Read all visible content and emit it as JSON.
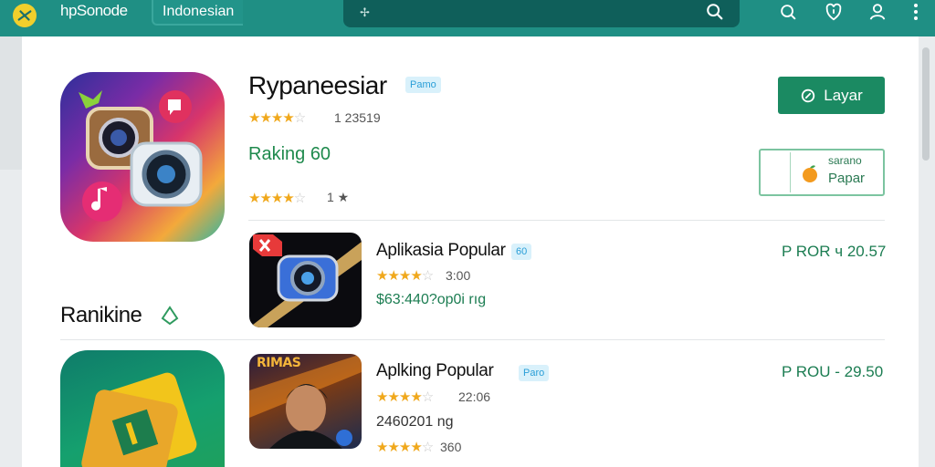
{
  "header": {
    "brand": "hpSonode",
    "language": "Indonesian",
    "search": {
      "value": ""
    }
  },
  "featured": {
    "title": "Rypaneesiar",
    "badge": "Pamo",
    "rating_stars": 4,
    "rating_text": "1 23519",
    "ranking": "Raking 60",
    "secondary_stars": 4,
    "secondary_text": "1 ★",
    "install_label": "Layar",
    "wishlist_top": "sarano",
    "wishlist_bottom": "Papar"
  },
  "section": {
    "title": "Ranikine"
  },
  "apps": [
    {
      "title": "Aplikasia Popular",
      "badge": "60",
      "stars": 4,
      "rating_text": "3:00",
      "info": "$63:440?op0i rıg",
      "price": "P ROR  ч 20.57"
    },
    {
      "title": "Aplking Popular",
      "badge": "Paro",
      "stars": 4,
      "rating_text": "22:06",
      "info": "2460201 ng",
      "stars2": 4,
      "rating_text2": "360",
      "price": "P ROU  -  29.50",
      "thumb_label": "RIMAS"
    }
  ],
  "colors": {
    "topbar": "#1f8f84",
    "accent": "#1b8a62",
    "star": "#f0a81c"
  }
}
